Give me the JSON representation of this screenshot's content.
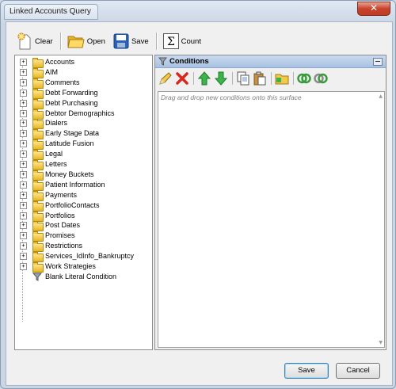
{
  "window": {
    "title": "Linked Accounts Query",
    "close_glyph": "✕"
  },
  "toolbar": {
    "clear_label": "Clear",
    "open_label": "Open",
    "save_label": "Save",
    "count_label": "Count"
  },
  "tree": {
    "items": [
      {
        "label": "Accounts",
        "icon": "folder-icon"
      },
      {
        "label": "AIM",
        "icon": "folder-icon"
      },
      {
        "label": "Comments",
        "icon": "folder-icon"
      },
      {
        "label": "Debt Forwarding",
        "icon": "folder-icon"
      },
      {
        "label": "Debt Purchasing",
        "icon": "folder-icon"
      },
      {
        "label": "Debtor Demographics",
        "icon": "folder-icon"
      },
      {
        "label": "Dialers",
        "icon": "folder-icon"
      },
      {
        "label": "Early Stage Data",
        "icon": "folder-icon"
      },
      {
        "label": "Latitude Fusion",
        "icon": "folder-icon"
      },
      {
        "label": "Legal",
        "icon": "folder-icon"
      },
      {
        "label": "Letters",
        "icon": "folder-icon"
      },
      {
        "label": "Money Buckets",
        "icon": "folder-icon"
      },
      {
        "label": "Patient Information",
        "icon": "folder-icon"
      },
      {
        "label": "Payments",
        "icon": "folder-icon"
      },
      {
        "label": "PortfolioContacts",
        "icon": "folder-icon"
      },
      {
        "label": "Portfolios",
        "icon": "folder-icon"
      },
      {
        "label": "Post Dates",
        "icon": "folder-icon"
      },
      {
        "label": "Promises",
        "icon": "folder-icon"
      },
      {
        "label": "Restrictions",
        "icon": "folder-icon"
      },
      {
        "label": "Services_IdInfo_Bankruptcy",
        "icon": "folder-icon"
      },
      {
        "label": "Work Strategies",
        "icon": "folder-icon"
      }
    ],
    "blank_condition_label": "Blank Literal Condition",
    "expander_glyph": "+"
  },
  "conditions": {
    "title": "Conditions",
    "surface_hint": "Drag and drop new conditions onto this surface"
  },
  "footer": {
    "save_label": "Save",
    "cancel_label": "Cancel"
  },
  "colors": {
    "accent": "#3c7fb1",
    "header": "#a9c2e2",
    "close": "#c8432c"
  }
}
